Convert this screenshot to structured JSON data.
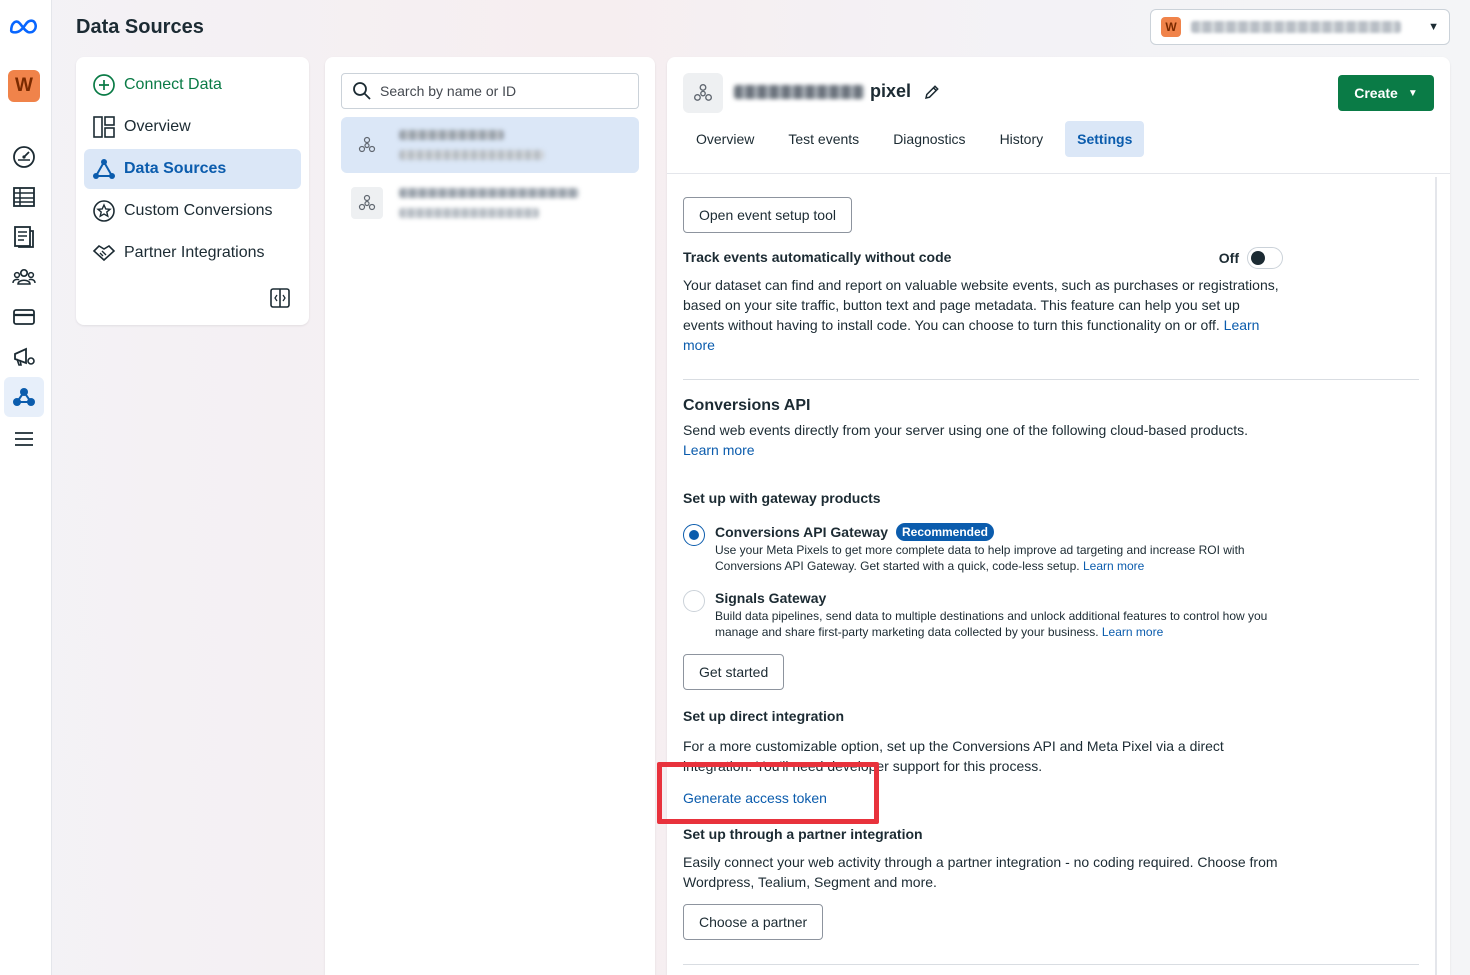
{
  "header": {
    "title": "Data Sources",
    "account_initial": "W"
  },
  "rail": {
    "avatar_initial": "W",
    "icons": [
      "meta-logo-icon",
      "dashboard-icon",
      "table-icon",
      "pages-icon",
      "audiences-icon",
      "billing-icon",
      "ads-manager-icon",
      "events-manager-icon",
      "menu-icon"
    ]
  },
  "nav": {
    "items": [
      {
        "label": "Connect Data",
        "icon": "plus-circle-icon"
      },
      {
        "label": "Overview",
        "icon": "layout-icon"
      },
      {
        "label": "Data Sources",
        "icon": "data-sources-icon"
      },
      {
        "label": "Custom Conversions",
        "icon": "star-badge-icon"
      },
      {
        "label": "Partner Integrations",
        "icon": "handshake-icon"
      }
    ]
  },
  "list": {
    "search_placeholder": "Search by name or ID"
  },
  "detail": {
    "pixel_suffix": "pixel",
    "create_label": "Create",
    "tabs": [
      "Overview",
      "Test events",
      "Diagnostics",
      "History",
      "Settings"
    ],
    "active_tab": "Settings",
    "open_event_setup_label": "Open event setup tool",
    "track_title": "Track events automatically without code",
    "track_toggle_label": "Off",
    "track_desc": "Your dataset can find and report on valuable website events, such as purchases or registrations, based on your site traffic, button text and page metadata. This feature can help you set up events without having to install code. You can choose to turn this functionality on or off.",
    "learn_more": "Learn more",
    "capi_title": "Conversions API",
    "capi_desc": "Send web events directly from your server using one of the following cloud-based products.",
    "gateway_title": "Set up with gateway products",
    "gateway_options": [
      {
        "title": "Conversions API Gateway",
        "badge": "Recommended",
        "desc": "Use your Meta Pixels to get more complete data to help improve ad targeting and increase ROI with Conversions API Gateway. Get started with a quick, code-less setup.",
        "checked": true
      },
      {
        "title": "Signals Gateway",
        "badge": "",
        "desc": "Build data pipelines, send data to multiple destinations and unlock additional features to control how you manage and share first-party marketing data collected by your business.",
        "checked": false
      }
    ],
    "get_started_label": "Get started",
    "direct_title": "Set up direct integration",
    "direct_desc": "For a more customizable option, set up the Conversions API and Meta Pixel via a direct integration. You'll need developer support for this process.",
    "generate_token_label": "Generate access token",
    "partner_title": "Set up through a partner integration",
    "partner_desc": "Easily connect your web activity through a partner integration - no coding required. Choose from Wordpress, Tealium, Segment and more.",
    "choose_partner_label": "Choose a partner"
  },
  "colors": {
    "primary_green": "#0a7b46",
    "link_blue": "#0b5cad",
    "highlight_red": "#e8323c"
  }
}
